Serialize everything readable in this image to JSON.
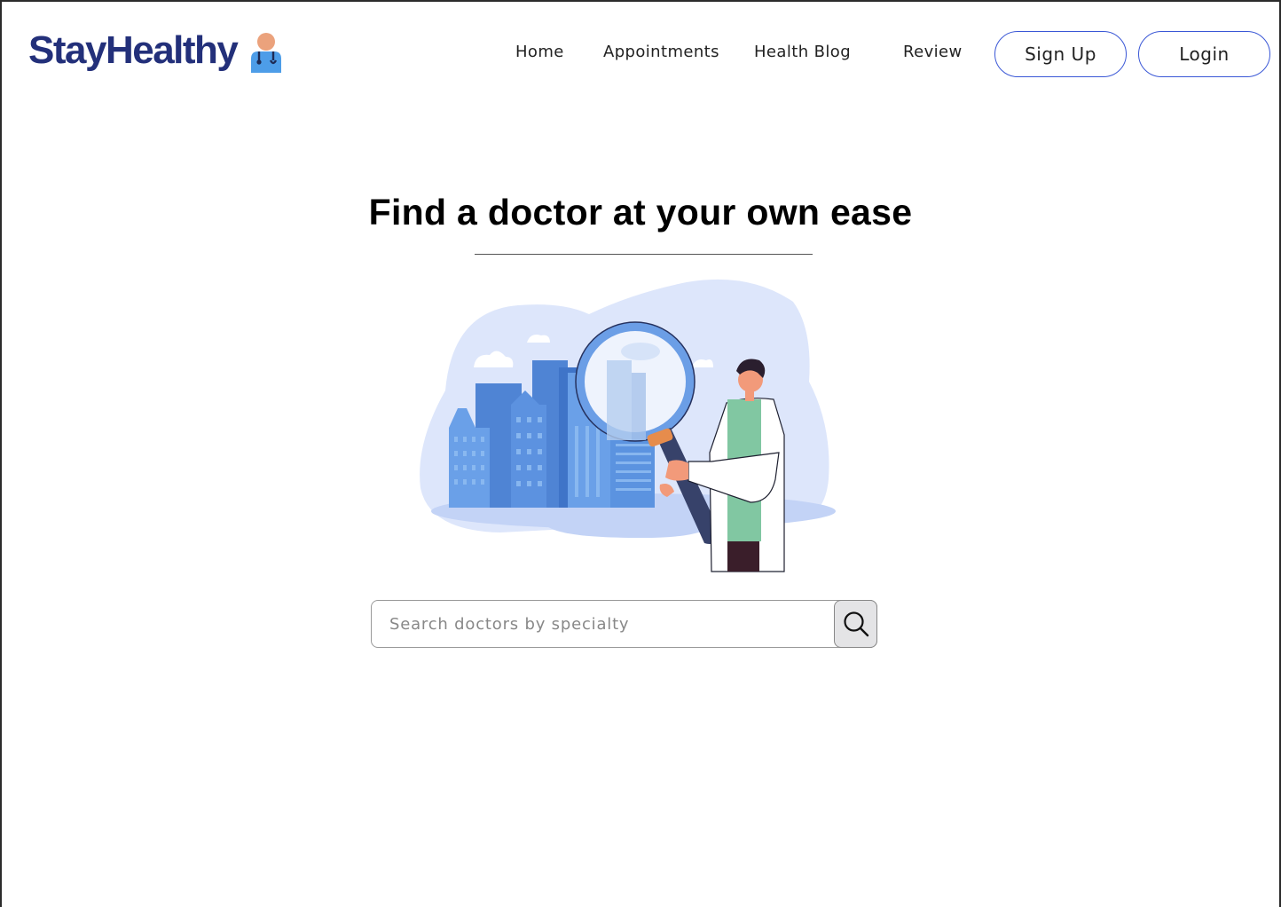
{
  "brand": {
    "name": "StayHealthy",
    "icon": "doctor-icon",
    "color": "#23307a"
  },
  "nav": {
    "links": [
      "Home",
      "Appointments",
      "Health Blog",
      "Review"
    ],
    "signup_label": "Sign Up",
    "login_label": "Login",
    "button_border_color": "#3a57d6"
  },
  "hero": {
    "title": "Find a doctor at your own ease",
    "illustration": "doctor-with-magnifying-glass-over-city"
  },
  "search": {
    "placeholder": "Search doctors by specialty",
    "value": "",
    "button_icon": "search-icon"
  }
}
